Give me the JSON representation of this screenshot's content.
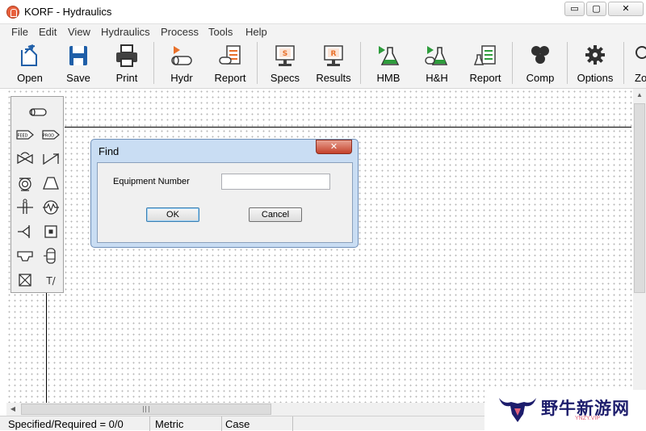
{
  "window": {
    "title": "KORF - Hydraulics",
    "minimize_glyph": "▭",
    "maximize_glyph": "▢",
    "close_glyph": "✕"
  },
  "menu": [
    "File",
    "Edit",
    "View",
    "Hydraulics",
    "Process",
    "Tools",
    "Help"
  ],
  "toolbar": [
    {
      "label": "Open",
      "icon": "open-icon"
    },
    {
      "label": "Save",
      "icon": "save-icon"
    },
    {
      "label": "Print",
      "icon": "print-icon"
    },
    {
      "label": "Hydr",
      "icon": "hydraulics-icon"
    },
    {
      "label": "Report",
      "icon": "report-icon"
    },
    {
      "label": "Specs",
      "icon": "specs-icon",
      "badge": "S"
    },
    {
      "label": "Results",
      "icon": "results-icon",
      "badge": "R"
    },
    {
      "label": "HMB",
      "icon": "hmb-icon"
    },
    {
      "label": "H&H",
      "icon": "h-and-h-icon"
    },
    {
      "label": "Report",
      "icon": "report-icon"
    },
    {
      "label": "Comp",
      "icon": "components-icon"
    },
    {
      "label": "Options",
      "icon": "gear-icon"
    },
    {
      "label": "Zo",
      "icon": "zoom-icon"
    }
  ],
  "palette": {
    "items": [
      "pipe-icon",
      "feed-icon",
      "product-icon",
      "valve-icon",
      "check-valve-icon",
      "pump-icon",
      "compressor-icon",
      "orifice-icon",
      "heat-exchanger-icon",
      "control-valve-icon",
      "equipment-icon",
      "nozzle-icon",
      "vessel-icon",
      "misc-equipment-icon",
      "text-icon"
    ],
    "feed_label": "FEED",
    "product_label": "PROD",
    "text_tool_label": "T/"
  },
  "dialog": {
    "title": "Find",
    "close_glyph": "✕",
    "field_label": "Equipment Number",
    "field_value": "",
    "ok_label": "OK",
    "cancel_label": "Cancel"
  },
  "statusbar": {
    "specified": "Specified/Required = 0/0",
    "units": "Metric",
    "case": "Case"
  },
  "watermark": {
    "text": "野牛新游网",
    "sub": "YNZY.VIP"
  },
  "colors": {
    "accent_blue": "#1f5fa8",
    "accent_green": "#2e9c3c",
    "accent_orange": "#e8702a",
    "dialog_frame": "#c9ddf3",
    "close_red": "#c4412b"
  }
}
